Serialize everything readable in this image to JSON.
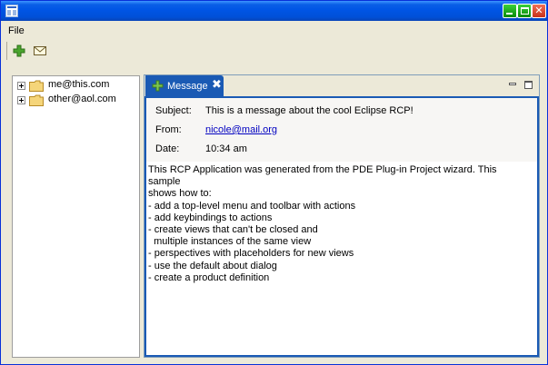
{
  "menu": {
    "file_label": "File"
  },
  "toolbar": {
    "add_icon": "plus-icon",
    "message_icon": "envelope-icon"
  },
  "navigation": {
    "items": [
      {
        "label": "me@this.com",
        "icon": "folder-icon"
      },
      {
        "label": "other@aol.com",
        "icon": "folder-icon"
      }
    ]
  },
  "message_view": {
    "tab_label": "Message",
    "close_glyph": "✖",
    "subject_label": "Subject:",
    "subject_value": "This is a message about the cool Eclipse RCP!",
    "from_label": "From:",
    "from_value": "nicole@mail.org",
    "date_label": "Date:",
    "date_value": "10:34 am",
    "body": "This RCP Application was generated from the PDE Plug-in Project wizard. This sample\nshows how to:\n- add a top-level menu and toolbar with actions\n- add keybindings to actions\n- create views that can't be closed and\n  multiple instances of the same view\n- perspectives with placeholders for new views\n- use the default about dialog\n- create a product definition"
  },
  "colors": {
    "titlebar": "#0055e5",
    "active_tab": "#1a5ab4",
    "link": "#0000c0",
    "toolbar_plus": "#3fa02a"
  }
}
